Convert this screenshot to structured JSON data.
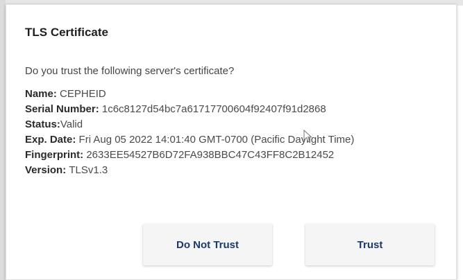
{
  "dialog": {
    "title": "TLS Certificate",
    "question": "Do you trust the following server's certificate?",
    "fields": [
      {
        "key": "Name: ",
        "value": "CEPHEID"
      },
      {
        "key": "Serial Number: ",
        "value": "1c6c8127d54bc7a61717700604f92407f91d2868"
      },
      {
        "key": "Status:",
        "value": "Valid"
      },
      {
        "key": "Exp. Date: ",
        "value": "Fri Aug 05 2022 14:01:40 GMT-0700 (Pacific Daylight Time)"
      },
      {
        "key": "Fingerprint: ",
        "value": "2633EE54527B6D72FA938BBC47C43FF8C2B12452"
      },
      {
        "key": "Version: ",
        "value": "TLSv1.3"
      }
    ],
    "buttons": {
      "do_not_trust": "Do Not Trust",
      "trust": "Trust"
    },
    "colors": {
      "button_text": "#1a3a6b",
      "button_bg": "#f5f5f5"
    }
  },
  "cursor_icon": "mouse-pointer-icon"
}
